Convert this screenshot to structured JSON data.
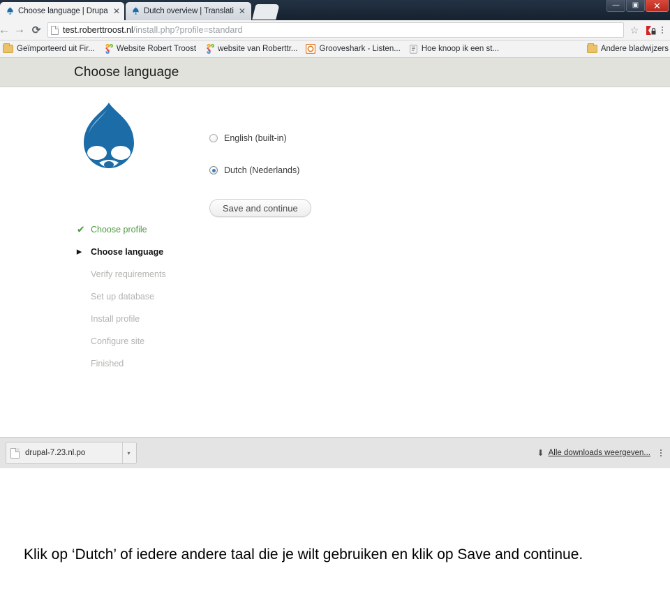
{
  "browser": {
    "tabs": [
      {
        "title": "Choose language | Drupal",
        "favicon": "drupal-droplet-icon",
        "active": true,
        "close_label": "✕"
      },
      {
        "title": "Dutch overview | Translati",
        "favicon": "drupal-droplet-icon",
        "active": false,
        "close_label": "✕"
      }
    ],
    "window_controls": {
      "minimize": "—",
      "maximize": "▣",
      "close": "✕"
    },
    "toolbar": {
      "back_icon": "←",
      "forward_icon": "→",
      "reload_icon": "⟳",
      "url_host": "test.roberttroost.nl",
      "url_path": "/install.php?profile=standard",
      "star_icon": "☆",
      "extension_icon": "lastpass-extension-icon",
      "menu_icon": "three-dots-menu-icon"
    },
    "bookmarks": [
      {
        "label": "Geïmporteerd uit Fir...",
        "icon": "folder-icon"
      },
      {
        "label": "Website Robert Troost",
        "icon": "joomla-icon"
      },
      {
        "label": "website van Roberttr...",
        "icon": "joomla-icon"
      },
      {
        "label": "Grooveshark - Listen...",
        "icon": "grooveshark-icon"
      },
      {
        "label": "Hoe knoop ik een st...",
        "icon": "generic-site-icon"
      }
    ],
    "bookmarks_other": {
      "label": "Andere bladwijzers",
      "icon": "folder-icon"
    },
    "downloads": {
      "file_name": "drupal-7.23.nl.po",
      "file_icon": "document-icon",
      "caret_icon": "▾",
      "show_all_label": "Alle downloads weergeven...",
      "download_arrow_icon": "⬇",
      "close_icon": "shelf-close-icon"
    }
  },
  "page": {
    "header_title": "Choose language",
    "logo": "drupal-droplet-logo",
    "steps": [
      {
        "label": "Choose profile",
        "state": "done",
        "mark": "✔"
      },
      {
        "label": "Choose language",
        "state": "active",
        "mark": "▶"
      },
      {
        "label": "Verify requirements",
        "state": "pending",
        "mark": ""
      },
      {
        "label": "Set up database",
        "state": "pending",
        "mark": ""
      },
      {
        "label": "Install profile",
        "state": "pending",
        "mark": ""
      },
      {
        "label": "Configure site",
        "state": "pending",
        "mark": ""
      },
      {
        "label": "Finished",
        "state": "pending",
        "mark": ""
      }
    ],
    "language_options": [
      {
        "label": "English (built-in)",
        "selected": false
      },
      {
        "label": "Dutch (Nederlands)",
        "selected": true
      }
    ],
    "save_button": "Save and continue"
  },
  "caption": {
    "text": "Klik op ‘Dutch’ of iedere andere taal die je wilt gebruiken en klik op Save and continue."
  },
  "colors": {
    "drupal_blue": "#1c6ca8",
    "header_bar": "#e2e2dd",
    "step_done_green": "#4e9a3f",
    "radio_selected": "#3a7fbf",
    "tab_bar": "#1d2b3c",
    "close_button_red": "#c3311f"
  }
}
